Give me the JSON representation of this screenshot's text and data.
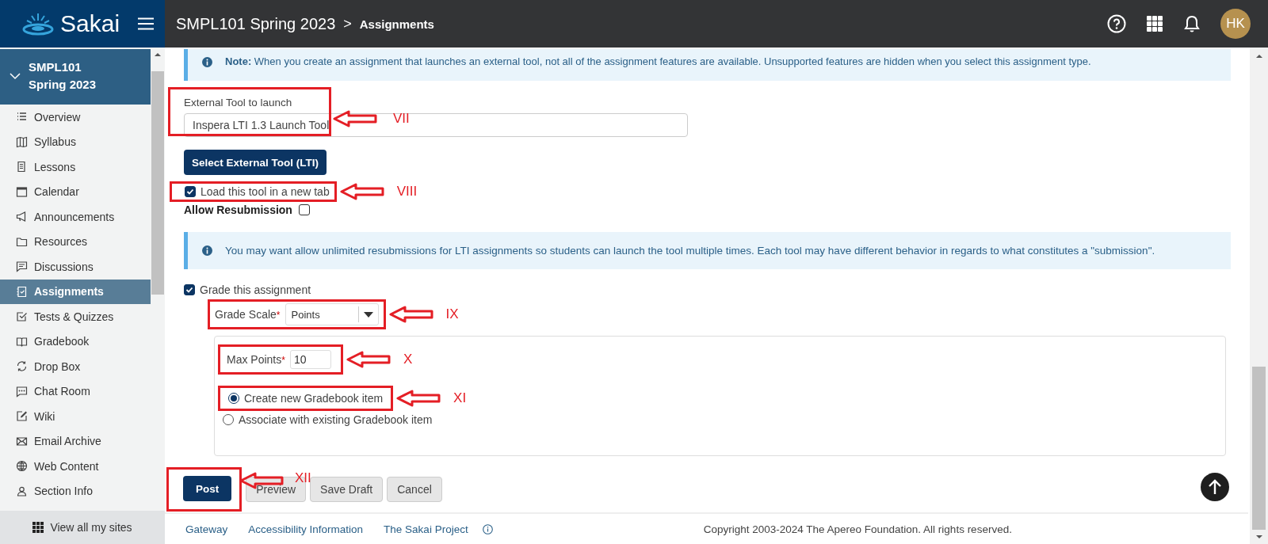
{
  "header": {
    "logo": "Sakai",
    "site": "SMPL101 Spring 2023",
    "separator": ">",
    "page": "Assignments",
    "avatar": "HK"
  },
  "sidebar": {
    "site": {
      "title": "SMPL101 Spring 2023",
      "expanded": true
    },
    "items": [
      {
        "label": "Overview",
        "selected": false
      },
      {
        "label": "Syllabus",
        "selected": false
      },
      {
        "label": "Lessons",
        "selected": false
      },
      {
        "label": "Calendar",
        "selected": false
      },
      {
        "label": "Announcements",
        "selected": false
      },
      {
        "label": "Resources",
        "selected": false
      },
      {
        "label": "Discussions",
        "selected": false
      },
      {
        "label": "Assignments",
        "selected": true
      },
      {
        "label": "Tests & Quizzes",
        "selected": false
      },
      {
        "label": "Gradebook",
        "selected": false
      },
      {
        "label": "Drop Box",
        "selected": false
      },
      {
        "label": "Chat Room",
        "selected": false
      },
      {
        "label": "Wiki",
        "selected": false
      },
      {
        "label": "Email Archive",
        "selected": false
      },
      {
        "label": "Web Content",
        "selected": false
      },
      {
        "label": "Section Info",
        "selected": false
      }
    ],
    "view_all": "View all my sites"
  },
  "form": {
    "note": "**Note:** When you create an assignment that launches an external tool, not all of the assignment features are available. Unsupported features are hidden when you select this assignment type.",
    "external_tool": {
      "label": "External Tool to launch",
      "value": "Inspera LTI 1.3 Launch Tool",
      "annotation": "VII"
    },
    "select_button": "Select External Tool (LTI)",
    "new_tab": {
      "label": "Load this tool in a new tab",
      "checked": true,
      "annotation": "VIII"
    },
    "allow_resubmission": {
      "label": "Allow Resubmission",
      "checked": false
    },
    "info": "You may want allow unlimited resubmissions for LTI assignments so students can launch the tool multiple times. Each tool may have different behavior in regards to what constitutes a \"submission\".",
    "grade": {
      "label": "Grade this assignment",
      "checked": true
    },
    "grade_scale": {
      "label": "Grade Scale",
      "required": "*",
      "value": "Points",
      "annotation": "IX"
    },
    "max_points": {
      "label": "Max Points",
      "required": "*",
      "value": "10",
      "annotation": "X"
    },
    "gradebook_options": [
      {
        "label": "Create new Gradebook item",
        "selected": true,
        "annotation": "XI"
      },
      {
        "label": "Associate with existing Gradebook item",
        "selected": false
      }
    ],
    "buttons": [
      {
        "label": "Post",
        "kind": "primary",
        "annotation": "XII"
      },
      {
        "label": "Preview",
        "kind": "default"
      },
      {
        "label": "Save Draft",
        "kind": "default"
      },
      {
        "label": "Cancel",
        "kind": "default"
      }
    ]
  },
  "footer": {
    "links": [
      "Gateway",
      "Accessibility Information",
      "The Sakai Project"
    ],
    "copyright": "Copyright 2003-2024 The Apereo Foundation. All rights reserved."
  }
}
